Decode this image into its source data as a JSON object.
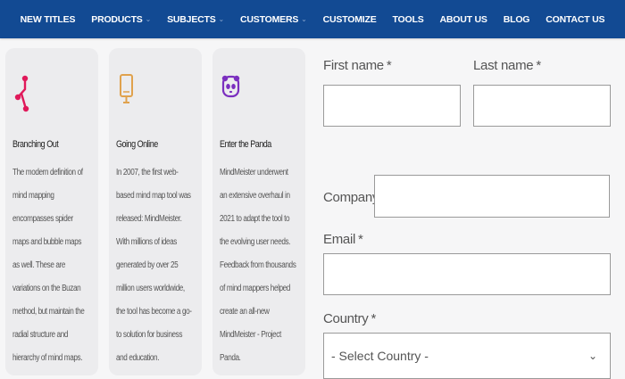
{
  "nav": {
    "items": [
      {
        "label": "NEW TITLES",
        "dropdown": false
      },
      {
        "label": "PRODUCTS",
        "dropdown": true
      },
      {
        "label": "SUBJECTS",
        "dropdown": true
      },
      {
        "label": "CUSTOMERS",
        "dropdown": true
      },
      {
        "label": "CUSTOMIZE",
        "dropdown": false
      },
      {
        "label": "TOOLS",
        "dropdown": false
      },
      {
        "label": "ABOUT US",
        "dropdown": false
      },
      {
        "label": "BLOG",
        "dropdown": false
      },
      {
        "label": "CONTACT US",
        "dropdown": false
      }
    ],
    "background": "#124a93"
  },
  "cards": [
    {
      "icon": "branch-icon",
      "icon_color": "#e0195a",
      "title": "Branching Out",
      "body": "The modern definition of mind mapping encompasses spider maps and bubble maps as well. These are variations on the Buzan method, but maintain the radial structure and hierarchy of mind maps."
    },
    {
      "icon": "tablet-icon",
      "icon_color": "#e0a24d",
      "title": "Going Online",
      "body": "In 2007, the first web-based mind map tool was released: MindMeister. With millions of ideas generated by over 25 million users worldwide, the tool has become a go-to solution for business and education."
    },
    {
      "icon": "panda-icon",
      "icon_color": "#7b2fbf",
      "title": "Enter the Panda",
      "body": "MindMeister underwent an extensive overhaul in 2021 to adapt the tool to the evolving user needs. Feedback from thousands of mind mappers helped create an all-new MindMeister - Project Panda."
    }
  ],
  "form": {
    "first_name_label": "First name",
    "last_name_label": "Last name",
    "company_label": "Company",
    "email_label": "Email",
    "country_label": "Country",
    "required_mark": "*",
    "first_name_value": "",
    "last_name_value": "",
    "company_value": "",
    "email_value": "",
    "country_selected": "- Select Country -"
  }
}
